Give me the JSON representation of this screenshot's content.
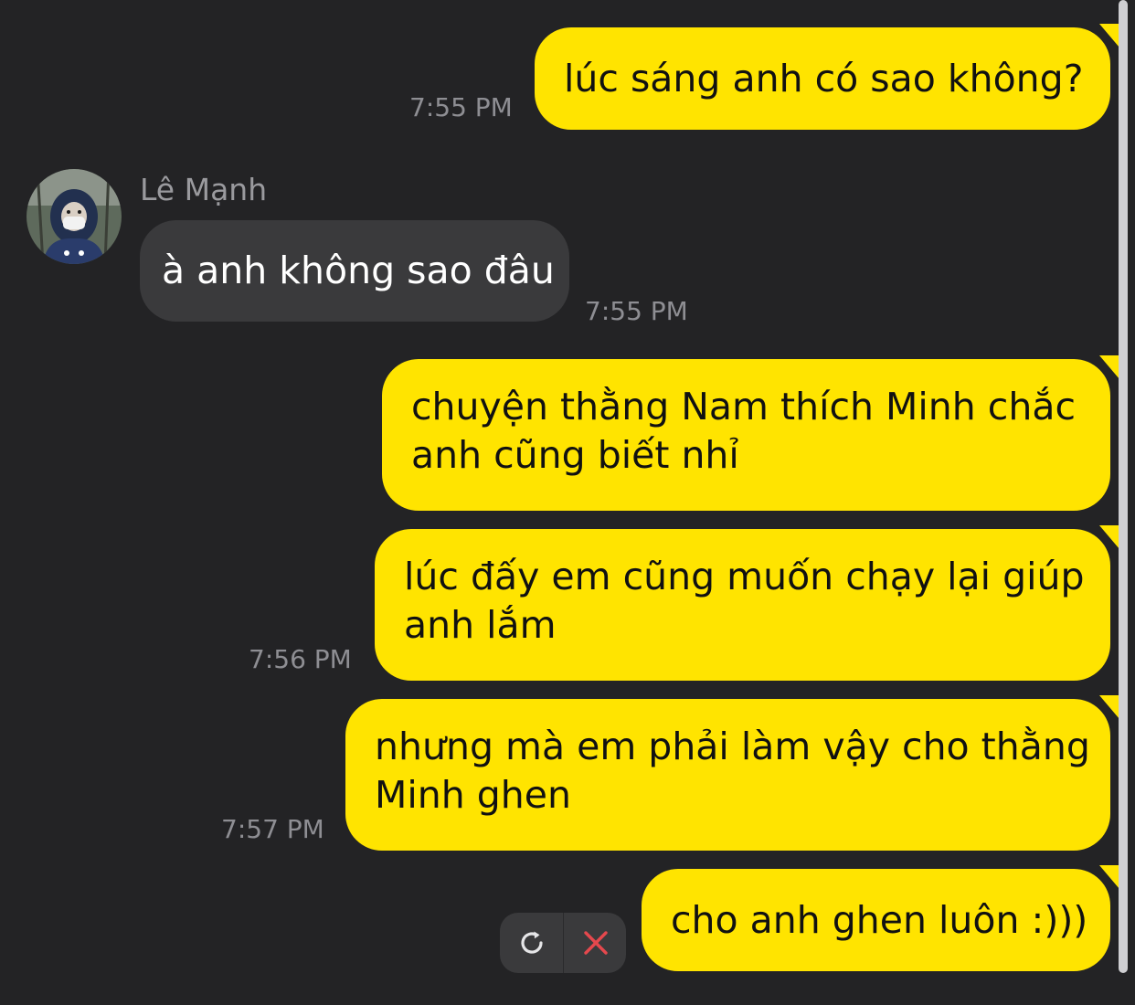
{
  "messages": [
    {
      "direction": "outgoing",
      "text": "lúc sáng anh có sao không?",
      "time": "7:55 PM"
    },
    {
      "direction": "incoming",
      "sender": "Lê Mạnh",
      "text": "à anh không sao đâu",
      "time": "7:55 PM"
    },
    {
      "direction": "outgoing",
      "lines": [
        "chuyện thằng Nam thích Minh chắc",
        "anh cũng biết nhỉ"
      ]
    },
    {
      "direction": "outgoing",
      "lines": [
        "lúc đấy em cũng muốn chạy lại giúp",
        "anh lắm"
      ],
      "time": "7:56 PM"
    },
    {
      "direction": "outgoing",
      "lines": [
        "nhưng mà em phải làm vậy cho thằng",
        "Minh ghen"
      ],
      "time": "7:57 PM"
    },
    {
      "direction": "outgoing",
      "text": "cho anh ghen luôn :)))",
      "status": "failed"
    }
  ],
  "actions": {
    "retry_icon": "refresh-icon",
    "cancel_icon": "close-icon"
  },
  "colors": {
    "background": "#232325",
    "outgoing_bubble": "#FFE400",
    "incoming_bubble": "#3A3A3C",
    "timestamp": "#8E8E93",
    "cancel": "#E5484D"
  }
}
